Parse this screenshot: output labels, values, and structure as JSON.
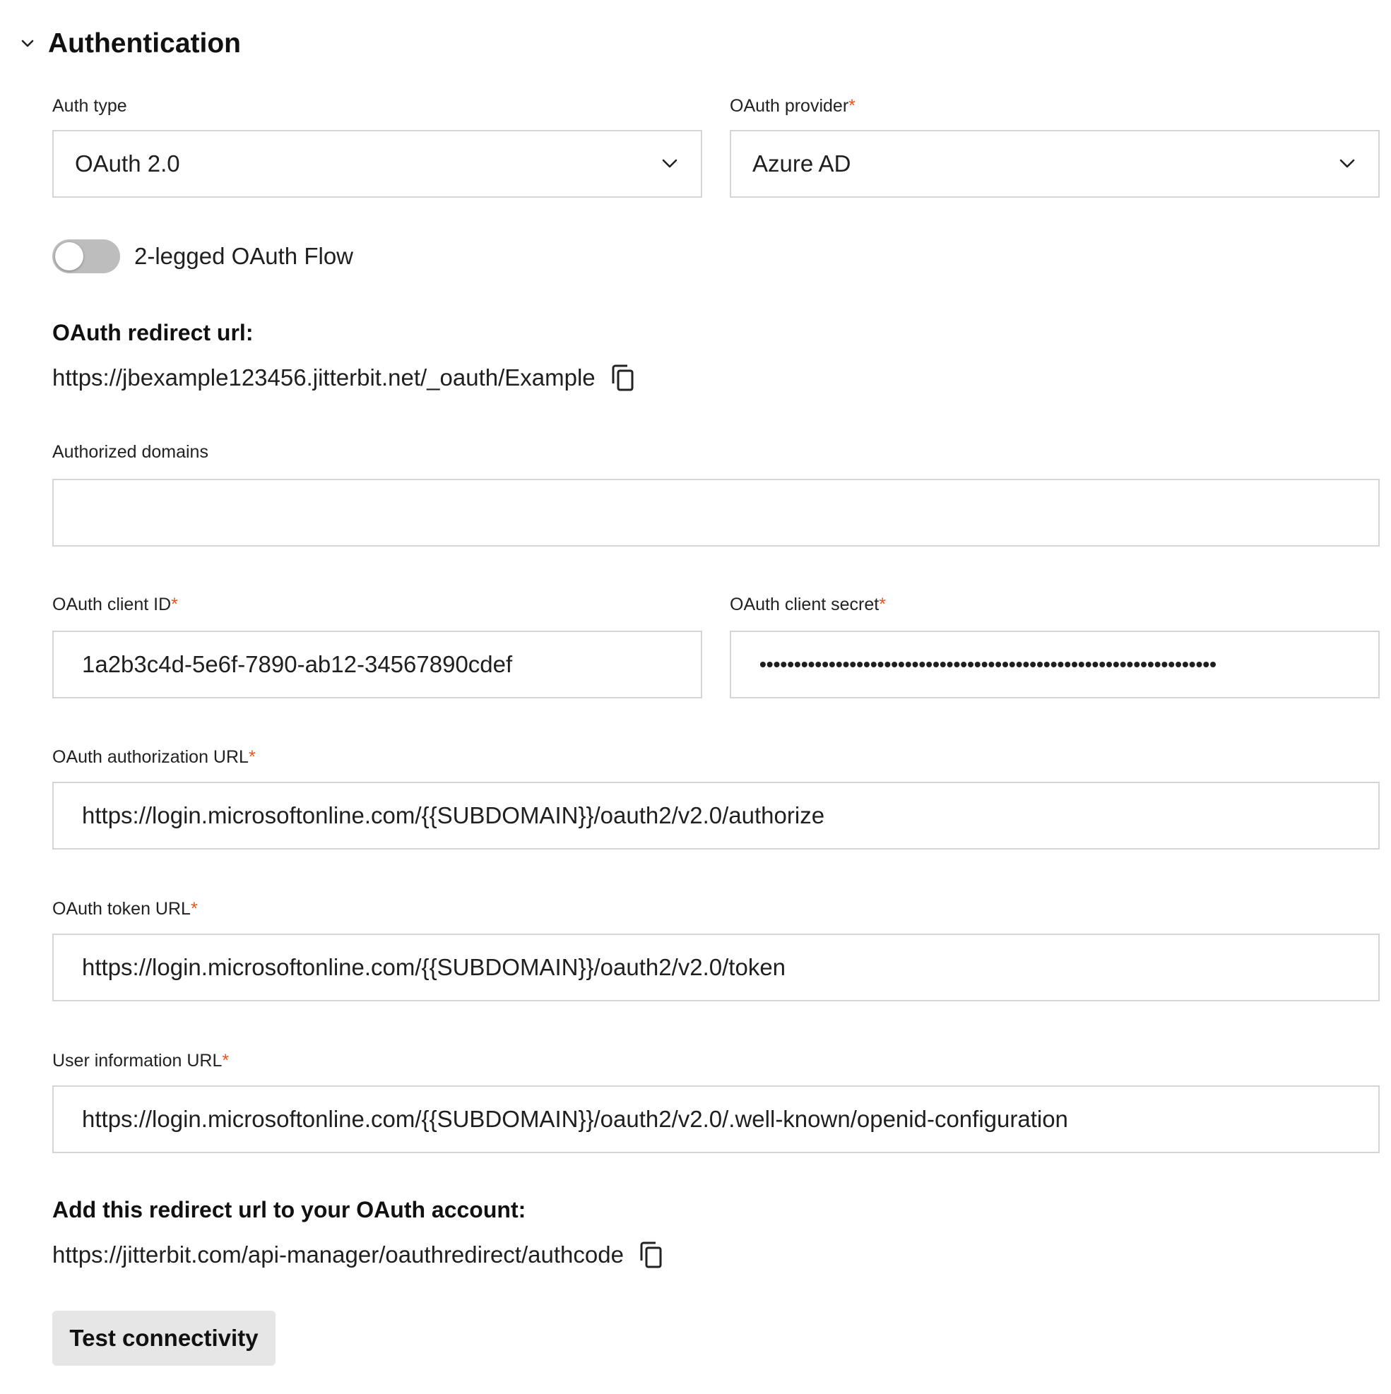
{
  "section": {
    "title": "Authentication"
  },
  "auth_type": {
    "label": "Auth type",
    "value": "OAuth 2.0"
  },
  "oauth_provider": {
    "label": "OAuth provider",
    "required_mark": "*",
    "value": "Azure AD"
  },
  "two_legged": {
    "label": "2-legged OAuth Flow",
    "enabled": false
  },
  "redirect_url": {
    "heading": "OAuth redirect url:",
    "value": "https://jbexample123456.jitterbit.net/_oauth/Example"
  },
  "authorized_domains": {
    "label": "Authorized domains",
    "value": ""
  },
  "client_id": {
    "label": "OAuth client ID",
    "required_mark": "*",
    "value": "1a2b3c4d-5e6f-7890-ab12-34567890cdef"
  },
  "client_secret": {
    "label": "OAuth client secret",
    "required_mark": "*",
    "value": "••••••••••••••••••••••••••••••••••••••••••••••••••••••••••••••••••"
  },
  "authorization_url": {
    "label": "OAuth authorization URL",
    "required_mark": "*",
    "value": "https://login.microsoftonline.com/{{SUBDOMAIN}}/oauth2/v2.0/authorize"
  },
  "token_url": {
    "label": "OAuth token URL",
    "required_mark": "*",
    "value": "https://login.microsoftonline.com/{{SUBDOMAIN}}/oauth2/v2.0/token"
  },
  "user_info_url": {
    "label": "User information URL",
    "required_mark": "*",
    "value": "https://login.microsoftonline.com/{{SUBDOMAIN}}/oauth2/v2.0/.well-known/openid-configuration"
  },
  "account_redirect": {
    "heading": "Add this redirect url to your OAuth account:",
    "value": "https://jitterbit.com/api-manager/oauthredirect/authcode"
  },
  "test_button": {
    "label": "Test connectivity"
  },
  "colors": {
    "required": "#e8541e",
    "border": "#d5d5d5",
    "button_bg": "#e6e6e6",
    "toggle_off": "#bdbdbd"
  },
  "icons": {
    "collapse": "chevron-down-icon",
    "select": "chevron-down-icon",
    "copy": "copy-icon"
  }
}
